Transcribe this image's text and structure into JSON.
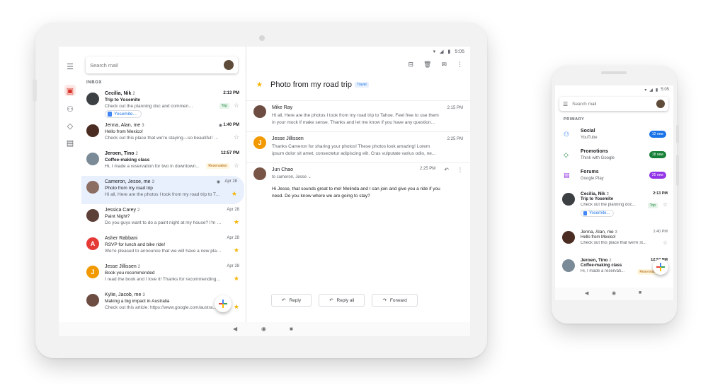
{
  "tablet": {
    "status": {
      "time": "5:05"
    },
    "search": {
      "placeholder": "Search mail"
    },
    "section_label": "INBOX",
    "emails": [
      {
        "sender": "Cecilia, Nik",
        "count": "2",
        "date": "2:13 PM",
        "subject": "Trip to Yosemite",
        "snippet": "Check out the planning doc and comment on your...",
        "chip": "Trip",
        "attachment": "Yosemite..."
      },
      {
        "sender": "Jenna, Alan, me",
        "count": "3",
        "date": "1:40 PM",
        "subject": "Hello from Mexico!",
        "snippet": "Check out this place that we're staying—so beautiful! We..."
      },
      {
        "sender": "Jeroen, Tino",
        "count": "2",
        "date": "12:57 PM",
        "subject": "Coffee-making class",
        "snippet": "Hi, I made a reservation for two in downtown...",
        "chip": "Reservation"
      },
      {
        "sender": "Cameron, Jesse, me",
        "count": "3",
        "date": "Apr 28",
        "subject": "Photo from my road trip",
        "snippet": "Hi all, Here are the photos I took from my road trip to Ta..."
      },
      {
        "sender": "Jessica Carey",
        "count": "2",
        "date": "Apr 28",
        "subject": "Paint Night?",
        "snippet": "Do you guys want to do a paint night at my house? I'm thin..."
      },
      {
        "sender": "Asher Rabbani",
        "date": "Apr 28",
        "subject": "RSVP for lunch and bike ride!",
        "snippet": "We're pleased to announce that we will have a new plan...",
        "initial": "A"
      },
      {
        "sender": "Jesse Jillissen",
        "count": "2",
        "date": "Apr 28",
        "subject": "Book you recommended",
        "snippet": "I read the book and I love it! Thanks for recommending...",
        "initial": "J"
      },
      {
        "sender": "Kylie, Jacob, me",
        "count": "3",
        "subject": "Making a big impact in Australia",
        "snippet": "Check out this article: https://www.google.com/austra..."
      }
    ],
    "thread": {
      "title": "Photo from my road trip",
      "label": "Travel",
      "messages": [
        {
          "from": "Mike Ray",
          "time": "2:15 PM",
          "body": "Hi all, Here are the photos I took from my road trip to Tahoe. Feel free to use them in your mock if make sense. Thanks and let me know if you have any question..."
        },
        {
          "from": "Jesse Jillissen",
          "time": "2:25 PM",
          "initial": "J",
          "body": "Thanks Cameron for sharing your photos! These photos look amazing! Lorem ipsum dolor sit amet, consectetur adipiscing elit. Cras vulputate varius odio, ne..."
        },
        {
          "from": "Jun Chao",
          "time": "2:25 PM",
          "to": "to cameron, Jesse",
          "body": "Hi Jesse, that sounds great to me! Melinda and I can join and give you a ride if you need. Do you know where we are going to stay?"
        }
      ]
    },
    "actions": {
      "reply": "Reply",
      "reply_all": "Reply all",
      "forward": "Forward"
    }
  },
  "phone": {
    "status": {
      "time": "5:05"
    },
    "search": {
      "placeholder": "Search mail"
    },
    "section_label": "PRIMARY",
    "categories": [
      {
        "name": "Social",
        "sub": "YouTube",
        "badge": "12 new",
        "color": "#1a73e8"
      },
      {
        "name": "Promotions",
        "sub": "Think with Google",
        "badge": "18 new",
        "color": "#188038"
      },
      {
        "name": "Forums",
        "sub": "Google Play",
        "badge": "25 new",
        "color": "#9334e6"
      }
    ],
    "emails": [
      {
        "sender": "Cecilia, Nik",
        "count": "2",
        "date": "2:13 PM",
        "subject": "Trip to Yosemite",
        "snippet": "Check out the planning doc...",
        "chip": "Trip",
        "attachment": "Yosemite..."
      },
      {
        "sender": "Jenna, Alan, me",
        "count": "3",
        "date": "1:40 PM",
        "subject": "Hello from Mexico!",
        "snippet": "Check out this place that we're st..."
      },
      {
        "sender": "Jeroen, Tino",
        "count": "2",
        "date": "12:57 PM",
        "subject": "Coffee-making class",
        "snippet": "Hi, I made a reservati...",
        "chip": "Reservation"
      }
    ]
  },
  "colors": {
    "accent": "#1a73e8",
    "star": "#f4b400",
    "selected_bg": "#e8f0fe"
  }
}
